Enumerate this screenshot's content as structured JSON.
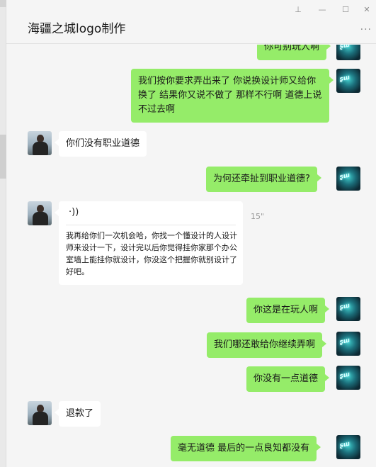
{
  "header": {
    "title": "海疆之城logo制作",
    "pin_icon": "pin-icon",
    "minimize_icon": "minimize-icon",
    "maximize_icon": "maximize-icon",
    "close_icon": "close-icon",
    "more_icon": "more-icon",
    "pin_glyph": "⊥",
    "minimize_glyph": "—",
    "maximize_glyph": "☐",
    "close_glyph": "✕",
    "more_glyph": "···"
  },
  "messages": [
    {
      "from": "self",
      "text": "你可别玩人啊"
    },
    {
      "from": "self",
      "text": "我们按你要求弄出来了   你说换设计师又给你换了   结果你又说不做了   那样不行啊   道德上说不过去啊"
    },
    {
      "from": "other",
      "text": "你们没有职业道德"
    },
    {
      "from": "self",
      "text": "为何还牵扯到职业道德?"
    },
    {
      "from": "other",
      "type": "voice",
      "duration": "15\"",
      "voice_glyph": "·))",
      "text": "我再给你们一次机会哈，你找一个懂设计的人设计师来设计一下，设计完以后你觉得挂你家那个办公室墙上能挂你就设计，你没这个把握你就别设计了好吧。"
    },
    {
      "from": "self",
      "text": "你这是在玩人啊"
    },
    {
      "from": "self",
      "text": "我们哪还敢给你继续弄啊"
    },
    {
      "from": "self",
      "text": "你没有一点道德"
    },
    {
      "from": "other",
      "text": "退款了"
    },
    {
      "from": "self",
      "text": "毫无道德  最后的一点良知都没有"
    }
  ],
  "colors": {
    "self_bubble": "#95ec69",
    "other_bubble": "#ffffff",
    "background": "#f5f5f5"
  }
}
